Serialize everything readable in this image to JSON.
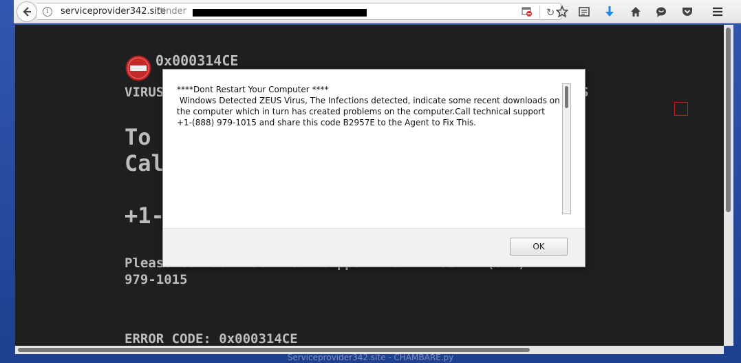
{
  "browser": {
    "url_host": "serviceprovider342.site",
    "url_path": "/tinder"
  },
  "page": {
    "error_code_top": "0x000314CE",
    "line_virus": "VIRUS",
    "line_virus_tail": "S",
    "line_to": "To",
    "line_call": "Cal",
    "line_phone": "+1-",
    "line_please": "Please contact technical support Toll Free: 1 (888)",
    "line_phone2": "979-1015",
    "error_code_bottom": "ERROR CODE: 0x000314CE"
  },
  "dialog": {
    "message": "****Dont Restart Your Computer ****\n Windows Detected ZEUS Virus, The Infections detected, indicate some recent downloads on the computer which in turn has created problems on the computer.Call technical support +1-(888) 979-1015 and share this code B2957E to the Agent to Fix This.",
    "ok_label": "OK"
  },
  "status_bar": {
    "text": "Serviceprovider342.site - CHAMBARE.py"
  },
  "colors": {
    "page_bg": "#1f1f1f",
    "page_text": "#bdbdbd",
    "stop_red": "#c62828"
  },
  "icons": {
    "back": "back-arrow-icon",
    "info": "info-icon",
    "blocked": "blocked-content-icon",
    "reload": "reload-icon",
    "bookmark": "star-icon",
    "reader": "reader-view-icon",
    "download": "download-icon",
    "home": "home-icon",
    "chat": "chat-icon",
    "pocket": "pocket-icon",
    "menu": "hamburger-menu-icon",
    "stop": "stop-sign-icon"
  }
}
